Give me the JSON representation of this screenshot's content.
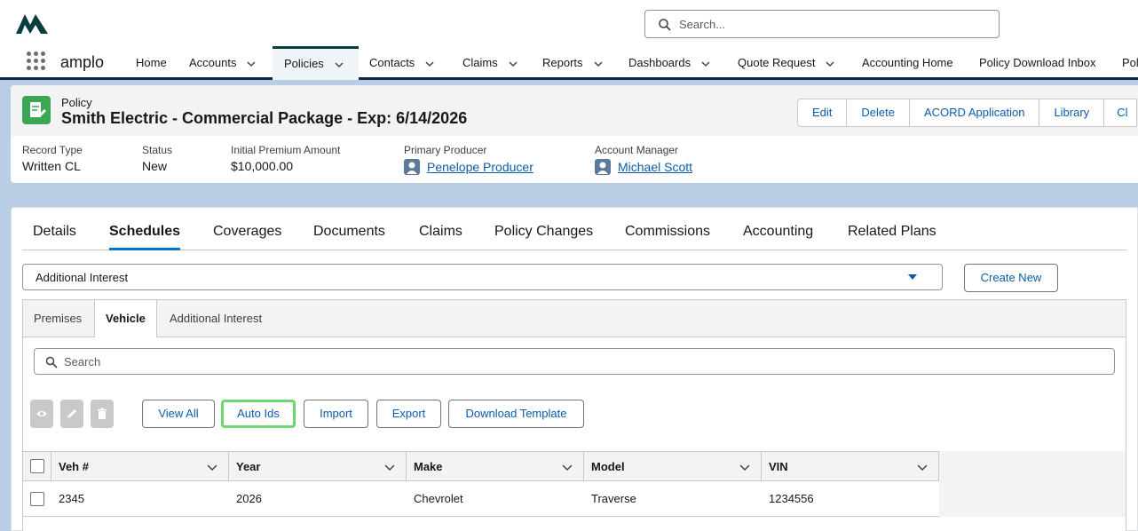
{
  "global_search": {
    "placeholder": "Search..."
  },
  "app": {
    "name": "amplo"
  },
  "nav": {
    "items": [
      {
        "label": "Home"
      },
      {
        "label": "Accounts"
      },
      {
        "label": "Policies"
      },
      {
        "label": "Contacts"
      },
      {
        "label": "Claims"
      },
      {
        "label": "Reports"
      },
      {
        "label": "Dashboards"
      },
      {
        "label": "Quote Request"
      },
      {
        "label": "Accounting Home"
      },
      {
        "label": "Policy Download Inbox"
      },
      {
        "label": "Pol"
      }
    ]
  },
  "record": {
    "type_label": "Policy",
    "title": "Smith Electric - Commercial Package - Exp: 6/14/2026",
    "actions": [
      "Edit",
      "Delete",
      "ACORD Application",
      "Library",
      "Cl"
    ],
    "fields": [
      {
        "label": "Record Type",
        "value": "Written CL"
      },
      {
        "label": "Status",
        "value": "New"
      },
      {
        "label": "Initial Premium Amount",
        "value": "$10,000.00"
      },
      {
        "label": "Primary Producer",
        "value": "Penelope Producer"
      },
      {
        "label": "Account Manager",
        "value": "Michael Scott"
      }
    ]
  },
  "tabs": [
    "Details",
    "Schedules",
    "Coverages",
    "Documents",
    "Claims",
    "Policy Changes",
    "Commissions",
    "Accounting",
    "Related Plans"
  ],
  "schedule_select": {
    "value": "Additional Interest"
  },
  "create_new": "Create New",
  "subtabs": [
    "Premises",
    "Vehicle",
    "Additional Interest"
  ],
  "schedule_search": {
    "placeholder": "Search"
  },
  "action_buttons": [
    "View All",
    "Auto Ids",
    "Import",
    "Export",
    "Download Template"
  ],
  "table": {
    "columns": [
      "Veh #",
      "Year",
      "Make",
      "Model",
      "VIN"
    ],
    "rows": [
      [
        "2345",
        "2026",
        "Chevrolet",
        "Traverse",
        "1234556"
      ]
    ]
  }
}
